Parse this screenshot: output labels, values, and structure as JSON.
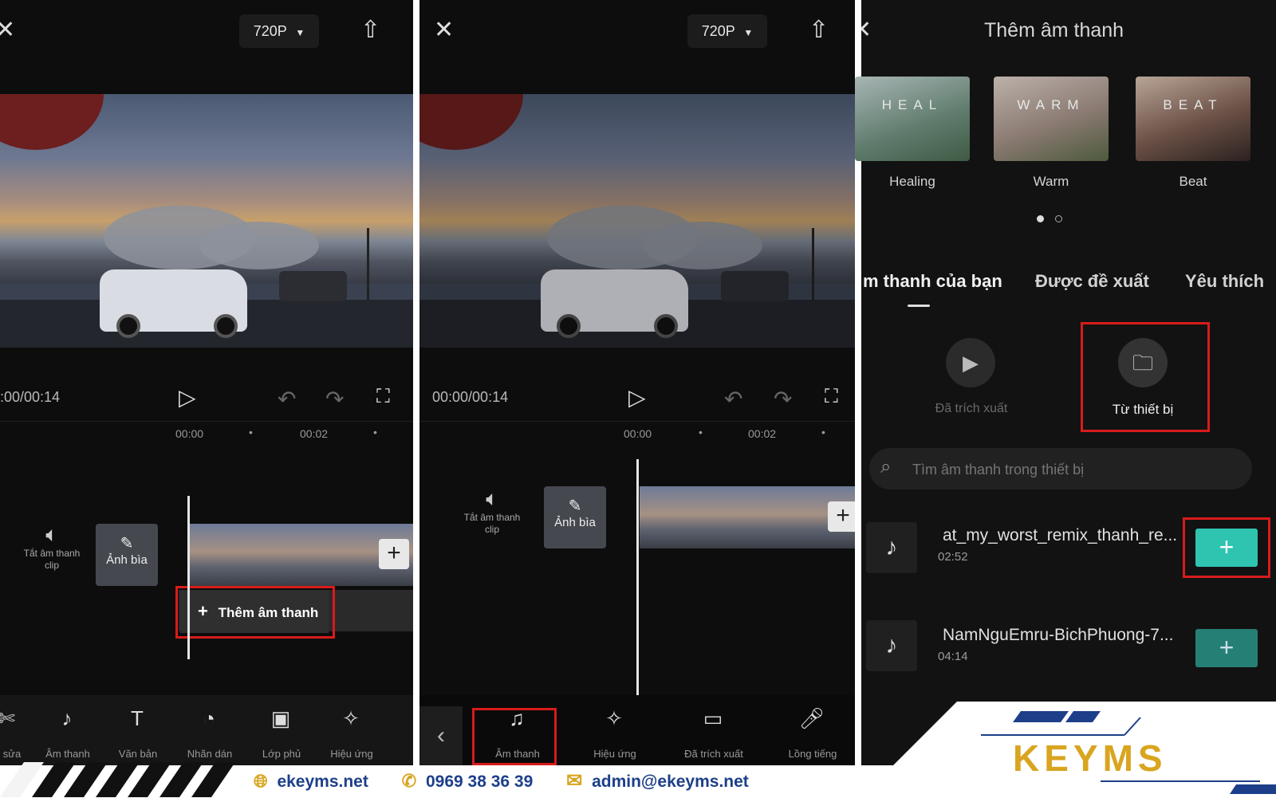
{
  "panel1": {
    "resolution": "720P",
    "time": ":00/00:14",
    "ruler": [
      "00:00",
      "00:02"
    ],
    "mute_label": "Tắt âm thanh clip",
    "cover_label": "Ảnh bìa",
    "add_audio_label": "Thêm âm thanh",
    "tools": [
      "sửa",
      "Âm thanh",
      "Văn bản",
      "Nhãn dán",
      "Lớp phủ",
      "Hiệu ứng"
    ]
  },
  "panel2": {
    "resolution": "720P",
    "time": "00:00/00:14",
    "ruler": [
      "00:00",
      "00:02"
    ],
    "mute_label": "Tắt âm thanh clip",
    "cover_label": "Ảnh bìa",
    "tools": [
      "Âm thanh",
      "Hiệu ứng",
      "Đã trích xuất",
      "Lồng tiếng"
    ]
  },
  "panel3": {
    "title": "Thêm âm thanh",
    "cards": [
      {
        "overlay": "HEAL",
        "label": "Healing"
      },
      {
        "overlay": "WARM",
        "label": "Warm"
      },
      {
        "overlay": "BEAT",
        "label": "Beat"
      }
    ],
    "tabs": [
      "m thanh của bạn",
      "Được đề xuất",
      "Yêu thích"
    ],
    "sources": [
      {
        "label": "Đã trích xuất"
      },
      {
        "label": "Từ thiết bị"
      }
    ],
    "search_placeholder": "Tìm âm thanh trong thiết bị",
    "tracks": [
      {
        "name": "at_my_worst_remix_thanh_re...",
        "duration": "02:52"
      },
      {
        "name": "NamNguEmru-BichPhuong-7...",
        "duration": "04:14"
      }
    ]
  },
  "footer": {
    "website": "ekeyms.net",
    "phone": "0969 38 36 39",
    "email": "admin@ekeyms.net",
    "logo_text": "KEYMS"
  },
  "colors": {
    "highlight": "#d81b1b",
    "accent_teal": "#2ec4b0",
    "brand_blue": "#1d3f8a",
    "brand_gold": "#d9a520"
  }
}
